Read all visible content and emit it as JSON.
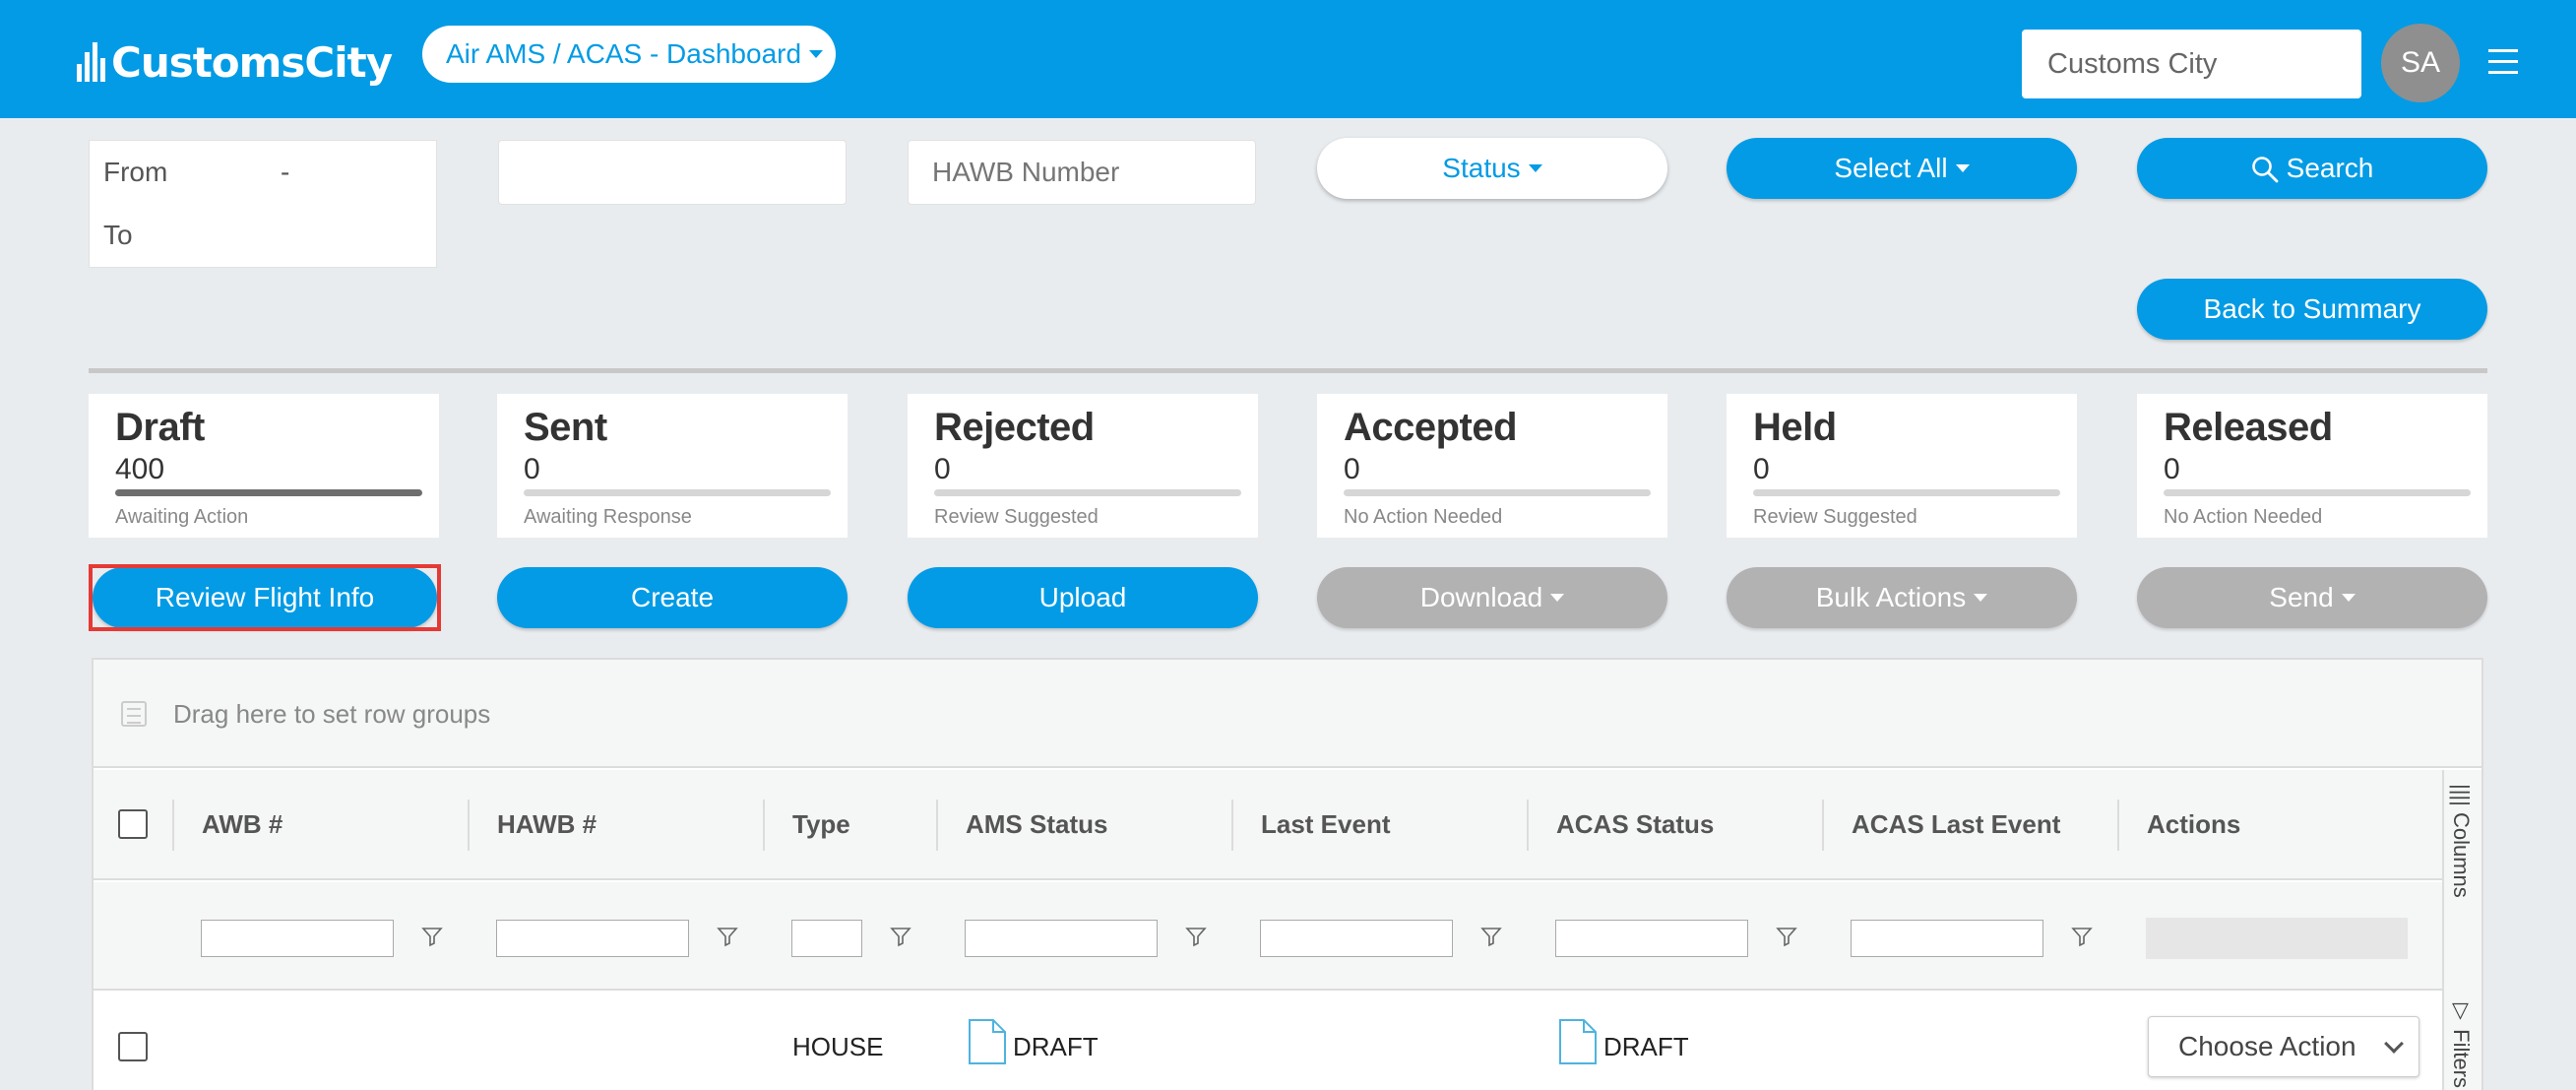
{
  "header": {
    "logo_text": "CustomsCity",
    "nav_label": "Air AMS / ACAS - Dashboard",
    "search_value": "Customs City",
    "avatar_initials": "SA"
  },
  "filters": {
    "from_label": "From",
    "date_separator": "-",
    "to_label": "To",
    "awb_placeholder": "",
    "hawb_placeholder": "HAWB Number",
    "status_label": "Status",
    "select_all_label": "Select All",
    "search_label": "Search",
    "back_label": "Back to Summary"
  },
  "cards": [
    {
      "title": "Draft",
      "count": "400",
      "sub": "Awaiting Action",
      "progress": 1.0
    },
    {
      "title": "Sent",
      "count": "0",
      "sub": "Awaiting Response",
      "progress": 0
    },
    {
      "title": "Rejected",
      "count": "0",
      "sub": "Review Suggested",
      "progress": 0
    },
    {
      "title": "Accepted",
      "count": "0",
      "sub": "No Action Needed",
      "progress": 0
    },
    {
      "title": "Held",
      "count": "0",
      "sub": "Review Suggested",
      "progress": 0
    },
    {
      "title": "Released",
      "count": "0",
      "sub": "No Action Needed",
      "progress": 0
    }
  ],
  "actions": {
    "review": "Review Flight Info",
    "create": "Create",
    "upload": "Upload",
    "download": "Download",
    "bulk": "Bulk Actions",
    "send": "Send"
  },
  "grid": {
    "group_hint": "Drag here to set row groups",
    "columns": [
      "AWB #",
      "HAWB #",
      "Type",
      "AMS Status",
      "Last Event",
      "ACAS Status",
      "ACAS Last Event",
      "Actions"
    ],
    "side_tabs": [
      "Columns",
      "Filters"
    ],
    "rows": [
      {
        "awb": "",
        "hawb": "",
        "type": "HOUSE",
        "ams_status": "DRAFT",
        "last_event": "",
        "acas_status": "DRAFT",
        "acas_last_event": "",
        "action": "Choose Action"
      }
    ]
  },
  "colors": {
    "brand": "#039be5",
    "highlight": "#e53935",
    "disabled": "#b2b2b2"
  }
}
